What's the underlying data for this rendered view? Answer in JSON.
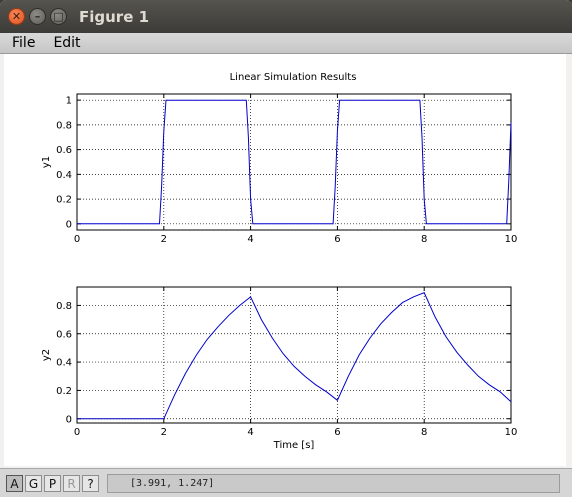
{
  "window": {
    "title": "Figure 1"
  },
  "menubar": {
    "items": [
      "File",
      "Edit"
    ]
  },
  "figure": {
    "title": "Linear Simulation Results"
  },
  "colors": {
    "line": "#0000cc",
    "grid": "#000000"
  },
  "toolbar": {
    "buttons": [
      "A",
      "G",
      "P",
      "R",
      "?"
    ],
    "coords": "[3.991, 1.247]"
  },
  "chart_data": [
    {
      "type": "line",
      "title": "Linear Simulation Results",
      "xlabel": "",
      "ylabel": "y1",
      "xlim": [
        0,
        10
      ],
      "ylim": [
        -0.05,
        1.05
      ],
      "xticks": [
        0,
        2,
        4,
        6,
        8,
        10
      ],
      "yticks": [
        0,
        0.2,
        0.4,
        0.6,
        0.8,
        1
      ],
      "ytick_labels": [
        "0",
        "0.2",
        "0.4",
        "0.6",
        "0.8",
        "1"
      ],
      "grid": true,
      "series": [
        {
          "x": [
            0,
            1.9,
            1.95,
            2.0,
            2.05,
            3.9,
            3.95,
            4.0,
            4.05,
            5.9,
            5.95,
            6.0,
            6.05,
            7.9,
            7.95,
            8.0,
            8.05,
            9.9,
            9.95,
            10.0
          ],
          "values": [
            0,
            0,
            0.3,
            0.75,
            1.0,
            1.0,
            0.7,
            0.2,
            0,
            0,
            0.3,
            0.75,
            1.0,
            1.0,
            0.7,
            0.2,
            0,
            0,
            0.35,
            0.82
          ]
        }
      ]
    },
    {
      "type": "line",
      "xlabel": "Time [s]",
      "ylabel": "y2",
      "xlim": [
        0,
        10
      ],
      "ylim": [
        -0.03,
        0.93
      ],
      "xticks": [
        0,
        2,
        4,
        6,
        8,
        10
      ],
      "yticks": [
        0,
        0.2,
        0.4,
        0.6,
        0.8
      ],
      "ytick_labels": [
        "0",
        "0.2",
        "0.4",
        "0.6",
        "0.8"
      ],
      "grid": true,
      "series": [
        {
          "x": [
            0,
            1.0,
            2.0,
            2.25,
            2.5,
            2.75,
            3.0,
            3.25,
            3.5,
            3.75,
            4.0,
            4.25,
            4.5,
            4.75,
            5.0,
            5.25,
            5.5,
            5.75,
            6.0,
            6.25,
            6.5,
            6.75,
            7.0,
            7.25,
            7.5,
            7.75,
            8.0,
            8.25,
            8.5,
            8.75,
            9.0,
            9.25,
            9.5,
            9.75,
            10.0
          ],
          "values": [
            0,
            0,
            0,
            0.17,
            0.32,
            0.45,
            0.56,
            0.65,
            0.73,
            0.8,
            0.86,
            0.7,
            0.57,
            0.46,
            0.37,
            0.3,
            0.24,
            0.19,
            0.13,
            0.3,
            0.45,
            0.57,
            0.67,
            0.75,
            0.82,
            0.86,
            0.89,
            0.72,
            0.58,
            0.47,
            0.38,
            0.3,
            0.24,
            0.19,
            0.12
          ]
        }
      ]
    }
  ]
}
